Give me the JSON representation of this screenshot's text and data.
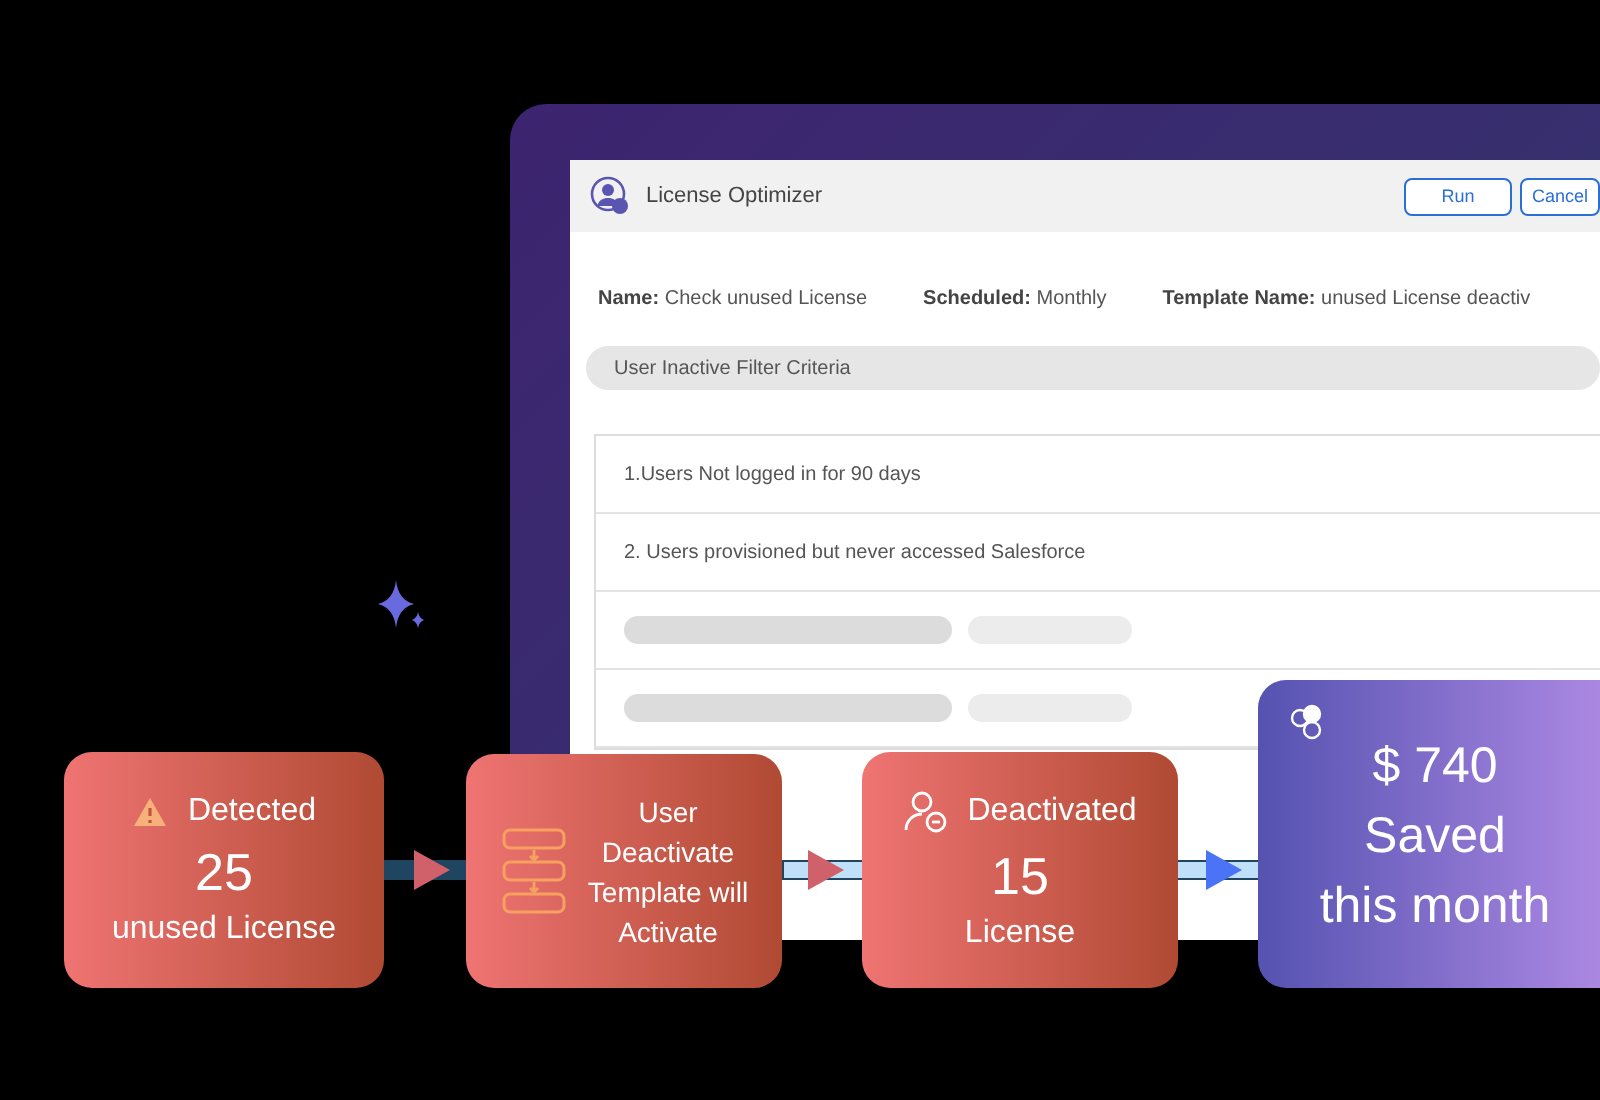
{
  "window": {
    "title": "License Optimizer",
    "buttons": [
      {
        "label": "Run"
      },
      {
        "label": "Cancel"
      }
    ]
  },
  "info": [
    {
      "label": "Name:",
      "value": "Check unused License"
    },
    {
      "label": "Scheduled:",
      "value": "Monthly"
    },
    {
      "label": "Template Name:",
      "value": "unused License deactiv"
    }
  ],
  "filter_header": "User Inactive Filter Criteria",
  "criteria": [
    {
      "kind": "text",
      "text": "1.Users Not logged in for 90 days"
    },
    {
      "kind": "text",
      "text": "2. Users provisioned but never accessed Salesforce"
    },
    {
      "kind": "skeleton"
    },
    {
      "kind": "skeleton"
    }
  ],
  "cards": [
    {
      "kind": "detected",
      "title": "Detected",
      "value": "25",
      "caption": "unused License"
    },
    {
      "kind": "template",
      "lines": [
        "User",
        "Deactivate",
        "Template will",
        "Activate"
      ]
    },
    {
      "kind": "deactivated",
      "title": "Deactivated",
      "value": "15",
      "caption": "License"
    },
    {
      "kind": "saved",
      "lines": [
        "$ 740",
        "Saved",
        "this month"
      ]
    }
  ]
}
